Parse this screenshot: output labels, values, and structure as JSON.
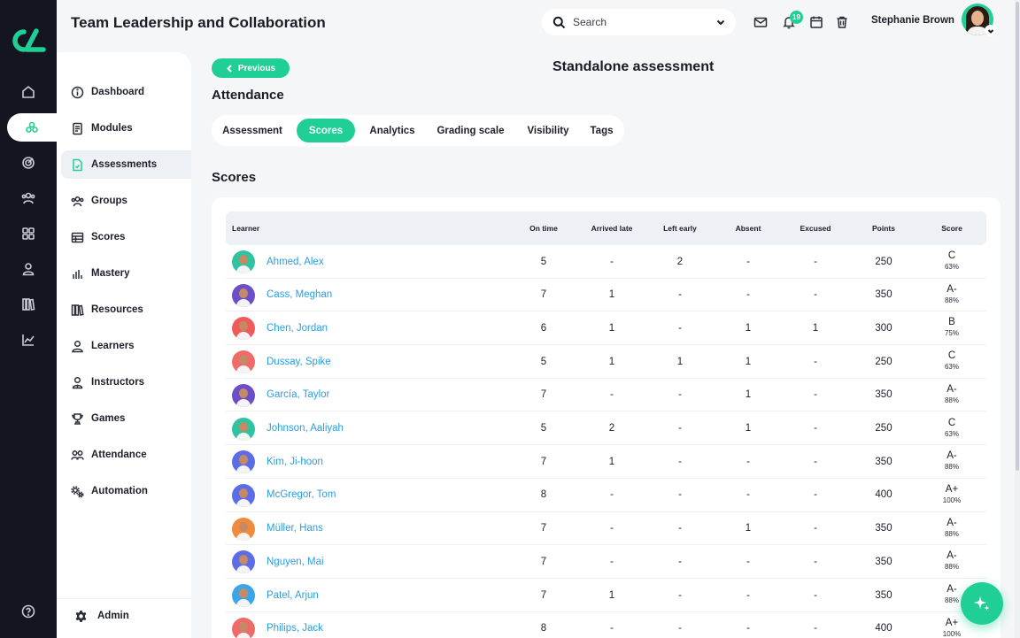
{
  "app": {
    "title": "Team Leadership and Collaboration"
  },
  "colors": {
    "accent": "#1fcf96",
    "rail": "#13151f",
    "link": "#2a9ee0"
  },
  "rail": {
    "icons": [
      "home-icon",
      "modules-icon",
      "target-icon",
      "users-icon",
      "grid-icon",
      "person-icon",
      "books-icon",
      "chart-icon",
      "help-icon"
    ],
    "active_index": 1
  },
  "sidebar": {
    "items": [
      {
        "label": "Dashboard",
        "icon": "info-icon"
      },
      {
        "label": "Modules",
        "icon": "document-icon"
      },
      {
        "label": "Assessments",
        "icon": "file-check-icon"
      },
      {
        "label": "Groups",
        "icon": "group-icon"
      },
      {
        "label": "Scores",
        "icon": "table-icon"
      },
      {
        "label": "Mastery",
        "icon": "bars-icon"
      },
      {
        "label": "Resources",
        "icon": "library-icon"
      },
      {
        "label": "Learners",
        "icon": "person-icon"
      },
      {
        "label": "Instructors",
        "icon": "instructor-icon"
      },
      {
        "label": "Games",
        "icon": "trophy-icon"
      },
      {
        "label": "Attendance",
        "icon": "attendance-icon"
      },
      {
        "label": "Automation",
        "icon": "cogs-icon"
      }
    ],
    "active_index": 2,
    "admin_label": "Admin"
  },
  "header": {
    "search_placeholder": "Search",
    "notification_count": "19",
    "user_name": "Stephanie Brown"
  },
  "page": {
    "previous_label": "Previous",
    "title": "Standalone assessment",
    "subtitle": "Attendance",
    "section_title": "Scores",
    "tabs": [
      "Assessment",
      "Scores",
      "Analytics",
      "Grading scale",
      "Visibility",
      "Tags"
    ],
    "active_tab": 1
  },
  "table": {
    "columns": [
      "Learner",
      "On time",
      "Arrived late",
      "Left early",
      "Absent",
      "Excused",
      "Points",
      "Score"
    ],
    "rows": [
      {
        "name": "Ahmed, Alex",
        "on_time": "5",
        "late": "-",
        "left_early": "2",
        "absent": "-",
        "excused": "-",
        "points": "250",
        "grade": "C",
        "percent": "63%",
        "avatar_color": "#2ec4a0"
      },
      {
        "name": "Cass, Meghan",
        "on_time": "7",
        "late": "1",
        "left_early": "-",
        "absent": "-",
        "excused": "-",
        "points": "350",
        "grade": "A-",
        "percent": "88%",
        "avatar_color": "#6a4fc8"
      },
      {
        "name": "Chen, Jordan",
        "on_time": "6",
        "late": "1",
        "left_early": "-",
        "absent": "1",
        "excused": "1",
        "points": "300",
        "grade": "B",
        "percent": "75%",
        "avatar_color": "#ef5b5b"
      },
      {
        "name": "Dussay, Spike",
        "on_time": "5",
        "late": "1",
        "left_early": "1",
        "absent": "1",
        "excused": "-",
        "points": "250",
        "grade": "C",
        "percent": "63%",
        "avatar_color": "#ef6b6b"
      },
      {
        "name": "García, Taylor",
        "on_time": "7",
        "late": "-",
        "left_early": "-",
        "absent": "1",
        "excused": "-",
        "points": "350",
        "grade": "A-",
        "percent": "88%",
        "avatar_color": "#6a4fc8"
      },
      {
        "name": "Johnson, Aaliyah",
        "on_time": "5",
        "late": "2",
        "left_early": "-",
        "absent": "1",
        "excused": "-",
        "points": "250",
        "grade": "C",
        "percent": "63%",
        "avatar_color": "#2ec4a0"
      },
      {
        "name": "Kim, Ji-hoon",
        "on_time": "7",
        "late": "1",
        "left_early": "-",
        "absent": "-",
        "excused": "-",
        "points": "350",
        "grade": "A-",
        "percent": "88%",
        "avatar_color": "#5b6ee8"
      },
      {
        "name": "McGregor, Tom",
        "on_time": "8",
        "late": "-",
        "left_early": "-",
        "absent": "-",
        "excused": "-",
        "points": "400",
        "grade": "A+",
        "percent": "100%",
        "avatar_color": "#5b6ee8"
      },
      {
        "name": "Müller, Hans",
        "on_time": "7",
        "late": "-",
        "left_early": "-",
        "absent": "1",
        "excused": "-",
        "points": "350",
        "grade": "A-",
        "percent": "88%",
        "avatar_color": "#f08a3c"
      },
      {
        "name": "Nguyen, Mai",
        "on_time": "7",
        "late": "-",
        "left_early": "-",
        "absent": "-",
        "excused": "-",
        "points": "350",
        "grade": "A-",
        "percent": "88%",
        "avatar_color": "#5b6ee8"
      },
      {
        "name": "Patel, Arjun",
        "on_time": "7",
        "late": "1",
        "left_early": "-",
        "absent": "-",
        "excused": "-",
        "points": "350",
        "grade": "A-",
        "percent": "88%",
        "avatar_color": "#3aa6e8"
      },
      {
        "name": "Philips, Jack",
        "on_time": "8",
        "late": "-",
        "left_early": "-",
        "absent": "-",
        "excused": "-",
        "points": "400",
        "grade": "A+",
        "percent": "100%",
        "avatar_color": "#ef6b6b"
      }
    ]
  }
}
